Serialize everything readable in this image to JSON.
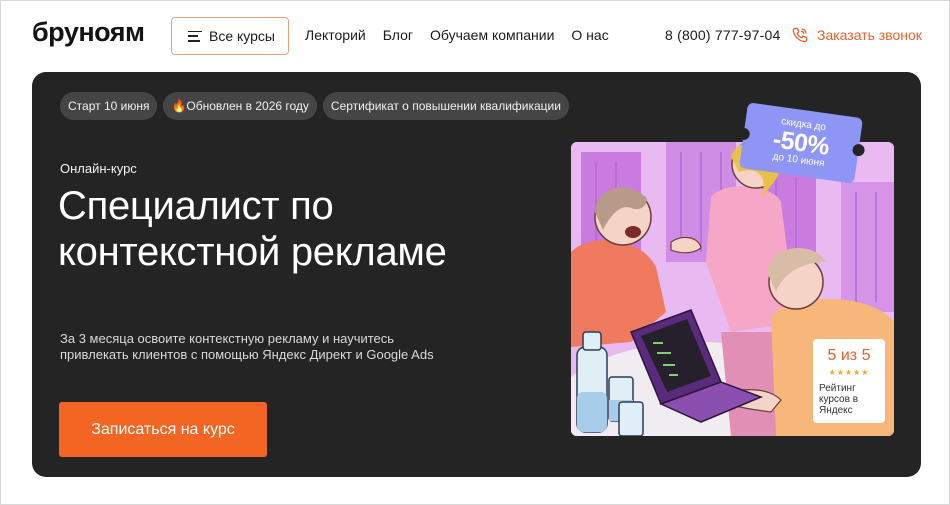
{
  "header": {
    "logo": "бруноям",
    "courses_button": "Все курсы",
    "nav": [
      "Лекторий",
      "Блог",
      "Обучаем компании",
      "О нас"
    ],
    "phone": "8 (800) 777-97-04",
    "callback": "Заказать звонок"
  },
  "hero": {
    "chips": [
      "Старт 10 июня",
      "🔥Обновлен в 2026 году",
      "Сертификат о повышении квалификации"
    ],
    "kicker": "Онлайн-курс",
    "title": "Специалист по контекстной рекламе",
    "description": "За 3 месяца освоите контекстную рекламу и научитесь привлекать клиентов с помощью Яндекс Директ и Google Ads",
    "cta": "Записаться на курс"
  },
  "discount": {
    "line1": "скидка до",
    "value": "-50%",
    "line3": "до 10 июня"
  },
  "rating": {
    "score": "5 из 5",
    "stars": 5,
    "label": "Рейтинг курсов в Яндекс"
  },
  "colors": {
    "accent": "#f26522",
    "hero_bg": "#242424",
    "ticket": "#8f95f4",
    "illustration_bg": "#e7b8ef"
  }
}
